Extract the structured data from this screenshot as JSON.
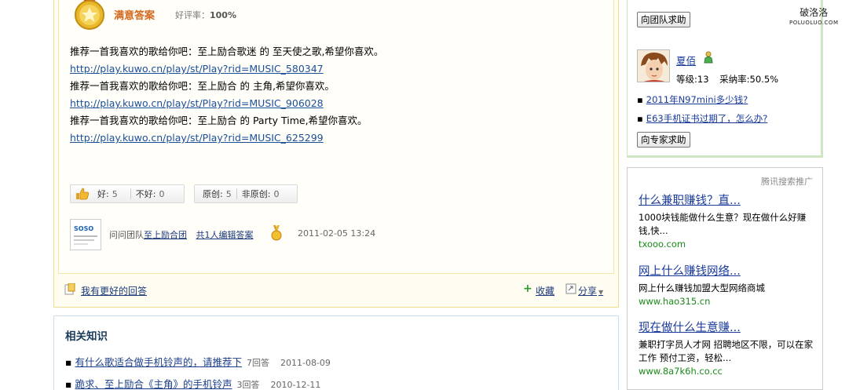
{
  "answer": {
    "title": "满意答案",
    "rate_label": "好评率：",
    "rate_value": "100%",
    "lines": [
      "推荐一首我喜欢的歌给你吧：至上励合歌迷 的 至天使之歌,希望你喜欢。",
      "http://play.kuwo.cn/play/st/Play?rid=MUSIC_580347",
      "推荐一首我喜欢的歌给你吧：至上励合 的 主角,希望你喜欢。",
      "http://play.kuwo.cn/play/st/Play?rid=MUSIC_906028",
      "推荐一首我喜欢的歌给你吧：至上励合 的 Party Time,希望你喜欢。",
      "http://play.kuwo.cn/play/st/Play?rid=MUSIC_625299"
    ],
    "votes": {
      "good_label": "好:",
      "good_count": "5",
      "bad_label": "不好:",
      "bad_count": "0",
      "original_label": "原创:",
      "original_count": "5",
      "nonoriginal_label": "非原创:",
      "nonoriginal_count": "0"
    },
    "team": {
      "prefix": "问问团队",
      "team_name": "至上励合团",
      "editors": "共1人编辑答案",
      "date": "2011-02-05 13:24",
      "logo_text": "SOSO"
    },
    "better_answer": "我有更好的回答",
    "favorite": "收藏",
    "share": "分享"
  },
  "related": {
    "title": "相关知识",
    "items": [
      {
        "text": "有什么歌适合做手机铃声的，请推荐下",
        "answers": "7回答",
        "date": "2011-08-09"
      },
      {
        "text": "跪求、至上励合《主角》的手机铃声",
        "answers": "3回答",
        "date": "2010-12-11"
      }
    ]
  },
  "sidebar": {
    "team_help": "向团队求助",
    "expert": {
      "name": "夏佰",
      "level": "等级:13",
      "adopt_rate": "采纳率:50.5%"
    },
    "questions": [
      "2011年N97mini多少钱?",
      "E63手机证书过期了，怎么办?"
    ],
    "expert_help": "向专家求助",
    "watermark_cn": "破洛洛",
    "watermark_en": "POLUOLUO.COM"
  },
  "ads": {
    "header": "腾讯搜索推广",
    "items": [
      {
        "title": "什么兼职赚钱？直...",
        "desc": "1000块钱能做什么生意？现在做什么好赚钱,快...",
        "url": "txooo.com"
      },
      {
        "title": "网上什么赚钱网络...",
        "desc": "网上什么赚钱加盟大型网络商城",
        "url": "www.hao315.cn"
      },
      {
        "title": "现在做什么生意赚...",
        "desc": "兼职打字员人才网 招聘地区不限，可以在家工作 预付工资，轻松...",
        "url": "www.8a7k6h.co.cc"
      }
    ]
  },
  "colors": {
    "accent": "#d2691e",
    "link": "#1a3a9a",
    "highlight": "#cc0000",
    "ad_url": "#1a8a1a"
  }
}
